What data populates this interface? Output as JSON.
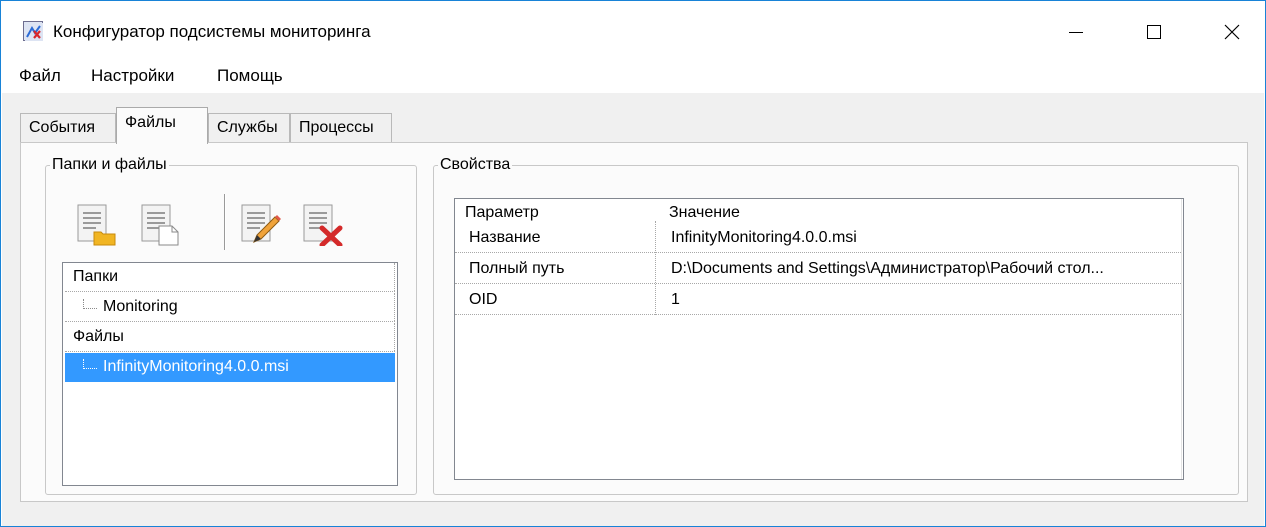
{
  "window": {
    "title": "Конфигуратор подсистемы мониторинга",
    "icon": "app-config-icon"
  },
  "menu": [
    "Файл",
    "Настройки",
    "Помощь"
  ],
  "tabs": [
    {
      "label": "События",
      "active": false
    },
    {
      "label": "Файлы",
      "active": true
    },
    {
      "label": "Службы",
      "active": false
    },
    {
      "label": "Процессы",
      "active": false
    }
  ],
  "files_group": {
    "legend": "Папки и файлы",
    "toolbar": [
      {
        "icon": "add-folder-icon"
      },
      {
        "icon": "add-file-icon"
      },
      {
        "icon": "edit-icon"
      },
      {
        "icon": "delete-icon"
      }
    ],
    "tree": [
      {
        "label": "Папки",
        "level": 0,
        "selected": false
      },
      {
        "label": "Monitoring",
        "level": 1,
        "selected": false
      },
      {
        "label": "Файлы",
        "level": 0,
        "selected": false
      },
      {
        "label": "InfinityMonitoring4.0.0.msi",
        "level": 1,
        "selected": true
      }
    ]
  },
  "props_group": {
    "legend": "Свойства",
    "columns": {
      "param": "Параметр",
      "value": "Значение"
    },
    "rows": [
      {
        "param": "Название",
        "value": "InfinityMonitoring4.0.0.msi"
      },
      {
        "param": "Полный путь",
        "value": "D:\\Documents and Settings\\Администратор\\Рабочий стол..."
      },
      {
        "param": "OID",
        "value": "1"
      }
    ]
  },
  "colors": {
    "window_border": "#1883d7",
    "selection": "#3399ff",
    "client_bg": "#f0f0f0",
    "tabpage_bg": "#fbfbfb"
  }
}
